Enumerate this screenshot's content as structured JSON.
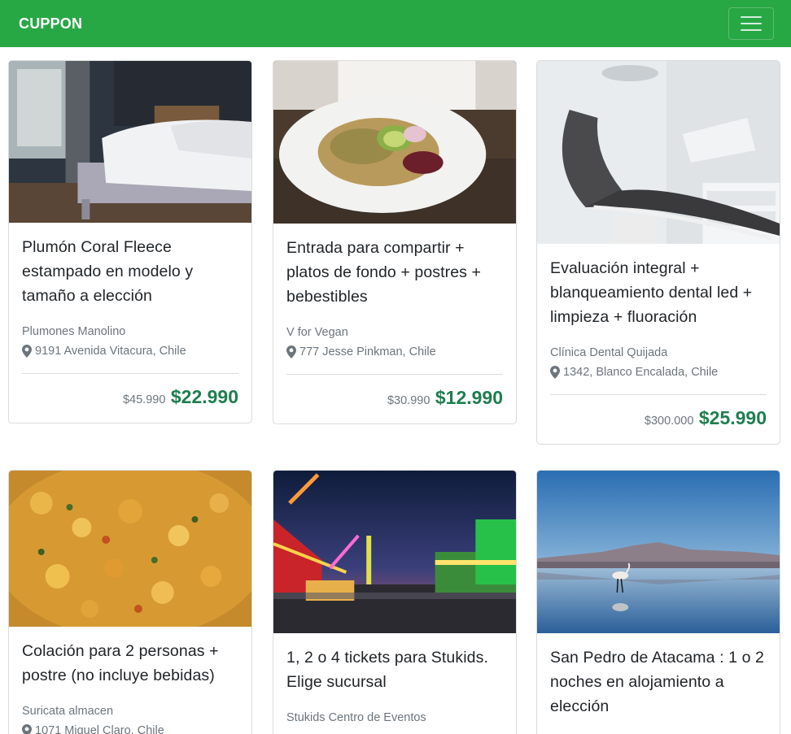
{
  "nav": {
    "brand": "CUPPON",
    "menu_icon": "hamburger-icon",
    "color": "#28a745"
  },
  "deals": [
    {
      "title": "Plumón Coral Fleece estampado en modelo y tamaño a elección",
      "merchant": "Plumones Manolino",
      "address": "9191 Avenida Vitacura, Chile",
      "old_price": "$45.990",
      "price": "$22.990",
      "image": "bedroom-photo"
    },
    {
      "title": "Entrada para compartir + platos de fondo + postres + bebestibles",
      "merchant": "V for Vegan",
      "address": "777 Jesse Pinkman, Chile",
      "old_price": "$30.990",
      "price": "$12.990",
      "image": "salad-plate-photo"
    },
    {
      "title": "Evaluación integral + blanqueamiento dental led + limpieza + fluoración",
      "merchant": "Clínica Dental Quijada",
      "address": "1342, Blanco Encalada, Chile",
      "old_price": "$300.000",
      "price": "$25.990",
      "image": "dental-chair-photo"
    },
    {
      "title": "Colación para 2 personas + postre (no incluye bebidas)",
      "merchant": "Suricata almacen",
      "address": "1071 Miguel Claro, Chile",
      "old_price": "",
      "price": "",
      "image": "food-dish-photo"
    },
    {
      "title": "1, 2 o 4 tickets para Stukids. Elige sucursal",
      "merchant": "Stukids Centro de Eventos",
      "address": "",
      "old_price": "",
      "price": "",
      "image": "amusement-park-photo"
    },
    {
      "title": "San Pedro de Atacama : 1 o 2 noches en alojamiento a elección",
      "merchant": "",
      "address": "",
      "old_price": "",
      "price": "",
      "image": "flamingo-lake-photo"
    }
  ],
  "colors": {
    "price": "#1e7e4f",
    "muted": "#6c757d"
  }
}
